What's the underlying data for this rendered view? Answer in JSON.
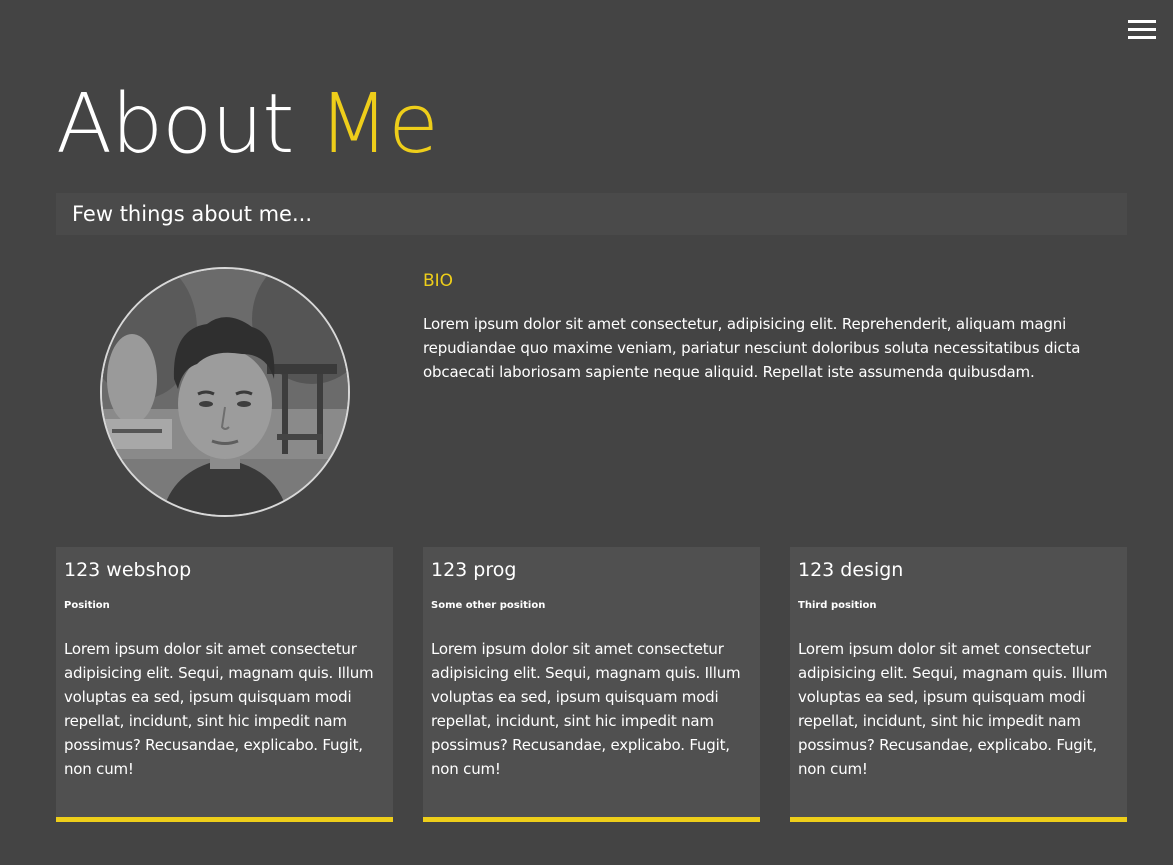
{
  "nav": {
    "menu_icon": "hamburger-menu-icon"
  },
  "header": {
    "title_part1": "About",
    "title_part2": "Me",
    "accent_color": "#eece1a",
    "subtitle": "Few things about me..."
  },
  "profile": {
    "photo": "portrait-photo-grayscale"
  },
  "bio": {
    "heading": "BIO",
    "text": "Lorem ipsum dolor sit amet consectetur, adipisicing elit. Reprehenderit, aliquam magni repudiandae quo maxime veniam, pariatur nesciunt doloribus soluta necessitatibus dicta obcaecati laboriosam sapiente neque aliquid. Repellat iste assumenda quibusdam."
  },
  "jobs": [
    {
      "company": "123 webshop",
      "position": "Position",
      "description": "Lorem ipsum dolor sit amet consectetur adipisicing elit. Sequi, magnam quis. Illum voluptas ea sed, ipsum quisquam modi repellat, incidunt, sint hic impedit nam possimus? Recusandae, explicabo. Fugit, non cum!"
    },
    {
      "company": "123 prog",
      "position": "Some other position",
      "description": "Lorem ipsum dolor sit amet consectetur adipisicing elit. Sequi, magnam quis. Illum voluptas ea sed, ipsum quisquam modi repellat, incidunt, sint hic impedit nam possimus? Recusandae, explicabo. Fugit, non cum!"
    },
    {
      "company": "123 design",
      "position": "Third position",
      "description": "Lorem ipsum dolor sit amet consectetur adipisicing elit. Sequi, magnam quis. Illum voluptas ea sed, ipsum quisquam modi repellat, incidunt, sint hic impedit nam possimus? Recusandae, explicabo. Fugit, non cum!"
    }
  ]
}
